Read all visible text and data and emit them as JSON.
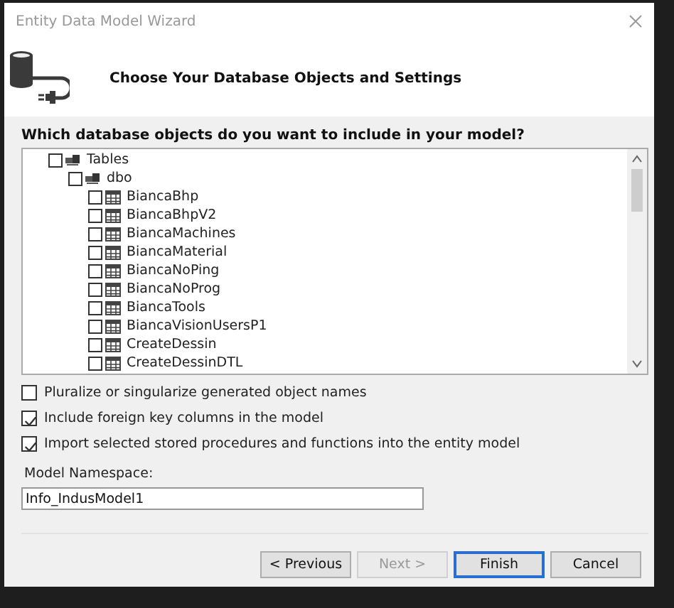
{
  "window": {
    "title": "Entity Data Model Wizard"
  },
  "header": {
    "title": "Choose Your Database Objects and Settings"
  },
  "tree": {
    "prompt": "Which database objects do you want to include in your model?",
    "items": [
      {
        "label": "Tables",
        "kind": "group",
        "checked": false,
        "children": [
          {
            "label": "dbo",
            "kind": "schema",
            "checked": false,
            "children": [
              {
                "label": "BiancaBhp",
                "kind": "table",
                "checked": false
              },
              {
                "label": "BiancaBhpV2",
                "kind": "table",
                "checked": false
              },
              {
                "label": "BiancaMachines",
                "kind": "table",
                "checked": false
              },
              {
                "label": "BiancaMaterial",
                "kind": "table",
                "checked": false
              },
              {
                "label": "BiancaNoPing",
                "kind": "table",
                "checked": false
              },
              {
                "label": "BiancaNoProg",
                "kind": "table",
                "checked": false
              },
              {
                "label": "BiancaTools",
                "kind": "table",
                "checked": false
              },
              {
                "label": "BiancaVisionUsersP1",
                "kind": "table",
                "checked": false
              },
              {
                "label": "CreateDessin",
                "kind": "table",
                "checked": false
              },
              {
                "label": "CreateDessinDTL",
                "kind": "table",
                "checked": false
              }
            ]
          }
        ]
      }
    ]
  },
  "options": [
    {
      "label": "Pluralize or singularize generated object names",
      "checked": false
    },
    {
      "label": "Include foreign key columns in the model",
      "checked": true
    },
    {
      "label": "Import selected stored procedures and functions into the entity model",
      "checked": true
    }
  ],
  "namespace": {
    "label": "Model Namespace:",
    "value": "Info_IndusModel1"
  },
  "buttons": [
    {
      "label": "< Previous",
      "disabled": false,
      "default": false
    },
    {
      "label": "Next >",
      "disabled": true,
      "default": false
    },
    {
      "label": "Finish",
      "disabled": false,
      "default": true
    },
    {
      "label": "Cancel",
      "disabled": false,
      "default": false
    }
  ]
}
